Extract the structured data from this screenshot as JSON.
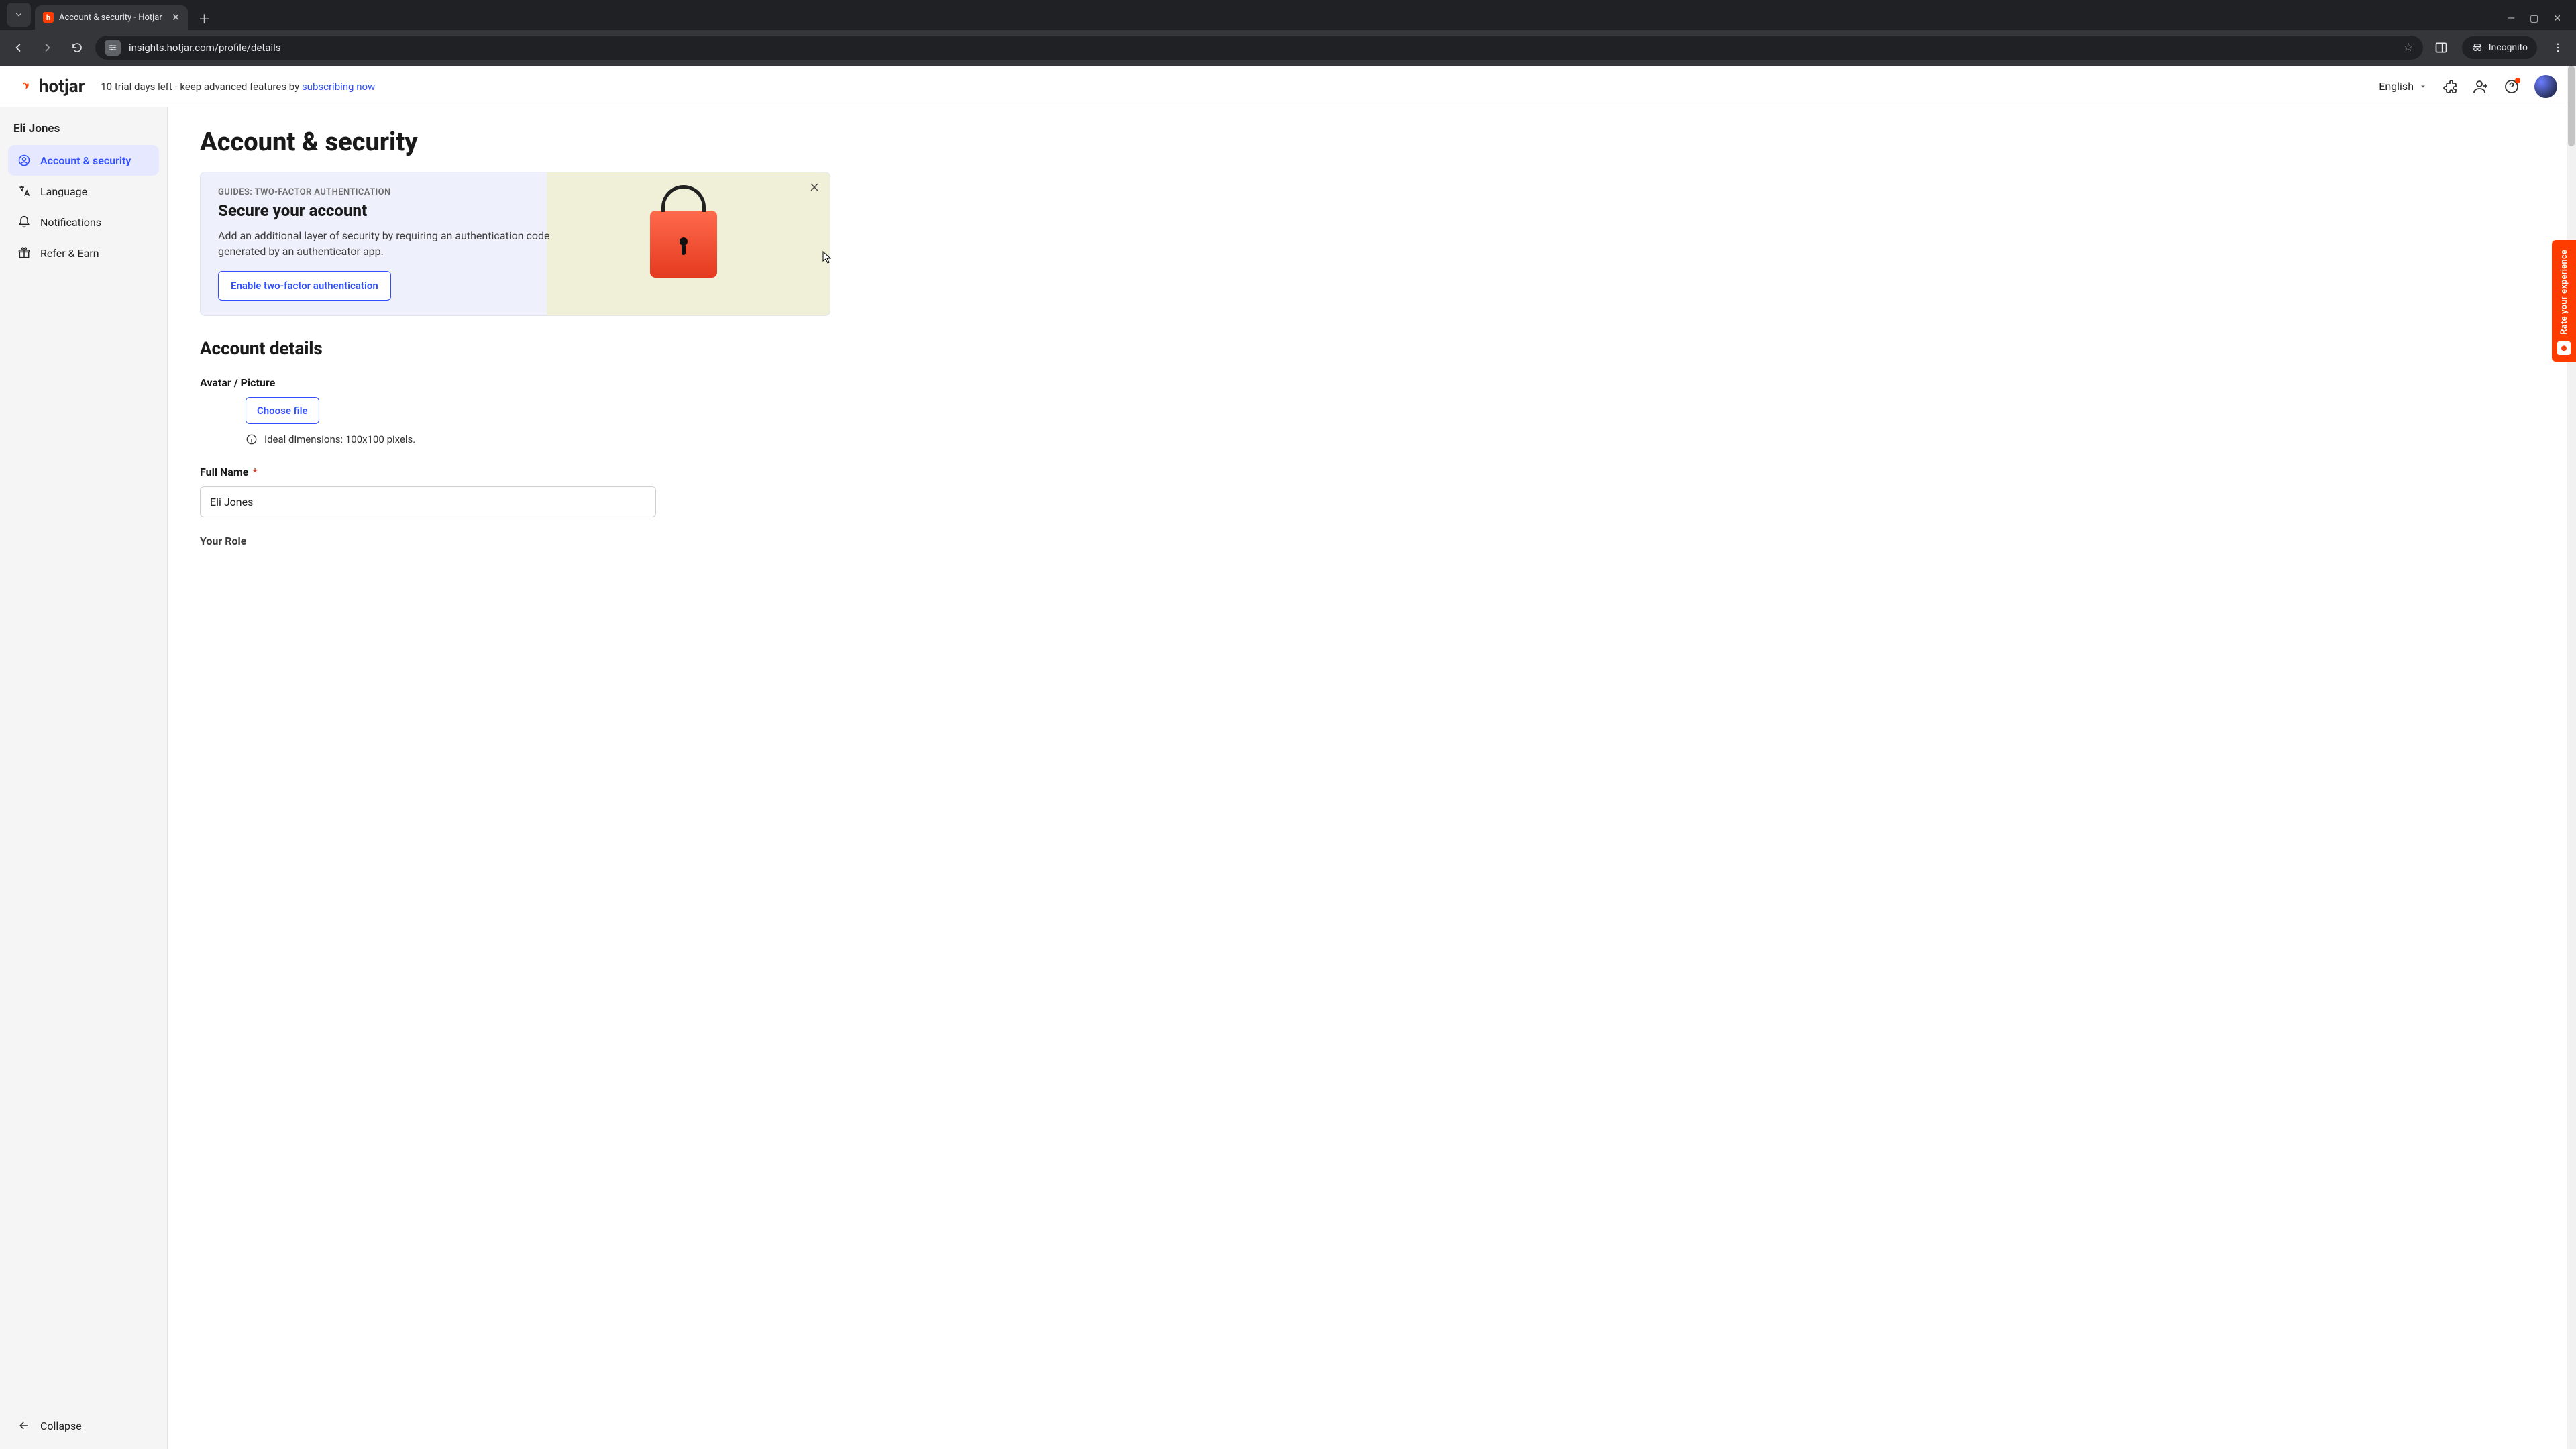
{
  "browser": {
    "tab_title": "Account & security - Hotjar",
    "url": "insights.hotjar.com/profile/details",
    "incognito_label": "Incognito"
  },
  "header": {
    "logo_text": "hotjar",
    "trial_prefix": "10 trial days left - keep advanced features by ",
    "trial_link": "subscribing now",
    "language": "English"
  },
  "sidebar": {
    "owner": "Eli Jones",
    "items": [
      {
        "label": "Account & security"
      },
      {
        "label": "Language"
      },
      {
        "label": "Notifications"
      },
      {
        "label": "Refer & Earn"
      }
    ],
    "collapse": "Collapse"
  },
  "page": {
    "title": "Account & security",
    "promo": {
      "eyebrow": "GUIDES: TWO-FACTOR AUTHENTICATION",
      "heading": "Secure your account",
      "body": "Add an additional layer of security by requiring an authentication code generated by an authenticator app.",
      "cta": "Enable two-factor authentication"
    },
    "details": {
      "section_title": "Account details",
      "avatar_label": "Avatar / Picture",
      "choose_file": "Choose file",
      "avatar_hint": "Ideal dimensions: 100x100 pixels.",
      "fullname_label": "Full Name",
      "fullname_value": "Eli Jones",
      "role_label": "Your Role"
    }
  },
  "feedback": {
    "label": "Rate your experience"
  }
}
